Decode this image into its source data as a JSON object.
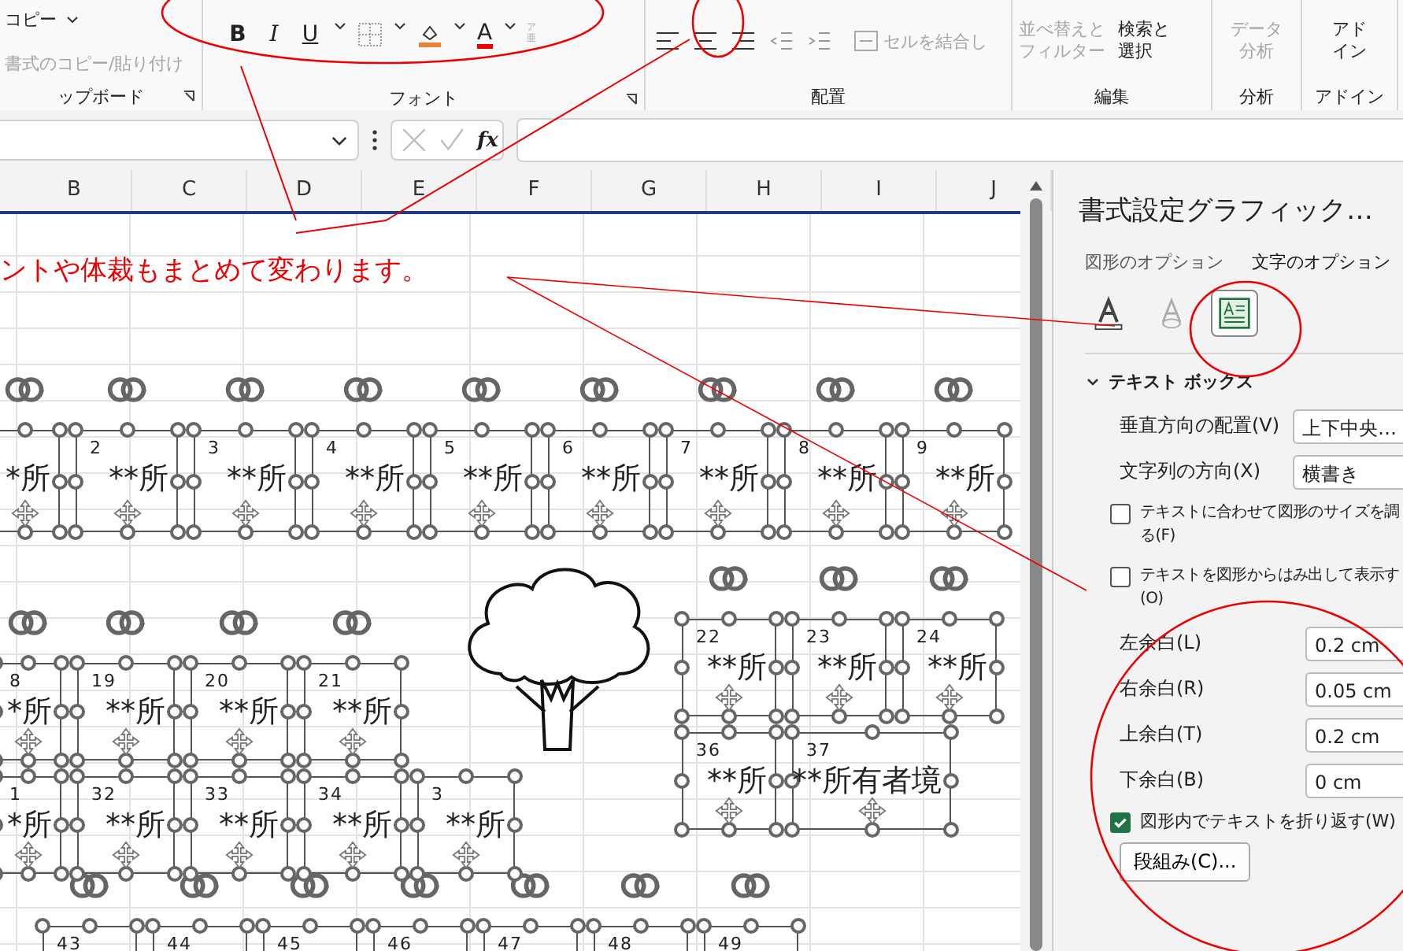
{
  "ribbon": {
    "clipboard": {
      "label": "ップボード",
      "copy": "コピー",
      "format_painter": {
        "label": "書式のコピー/貼り付け",
        "disabled": true
      }
    },
    "font": {
      "label": "フォント",
      "bold": "B",
      "italic": "I",
      "underline": "U",
      "font_color": "A",
      "phonetic": "ア亜"
    },
    "alignment": {
      "label": "配置",
      "merge": {
        "label": "セルを結合し",
        "disabled": true
      }
    },
    "editing": {
      "label": "編集",
      "sort_filter": {
        "lines": [
          "並べ替えと",
          "フィルター"
        ],
        "disabled": true
      },
      "find_select": {
        "lines": [
          "検索と",
          "選択"
        ],
        "disabled": false
      }
    },
    "analysis": {
      "label": "分析",
      "data_analysis": {
        "lines": [
          "データ",
          "分析"
        ],
        "disabled": true
      }
    },
    "addins": {
      "label": "アドイン",
      "addin": {
        "lines": [
          "アド",
          "イン"
        ]
      }
    }
  },
  "formula_bar": {
    "fx": "fx"
  },
  "columns": [
    "B",
    "C",
    "D",
    "E",
    "F",
    "G",
    "H",
    "I",
    "J"
  ],
  "annotation": "ントや体裁もまとめて変わります。",
  "shape_groups": [
    {
      "items": [
        {
          "text": "*所"
        },
        {
          "number": "2",
          "text": "**所"
        },
        {
          "number": "3",
          "text": "**所"
        },
        {
          "number": "4",
          "text": "**所"
        },
        {
          "number": "5",
          "text": "**所"
        },
        {
          "number": "6",
          "text": "**所"
        },
        {
          "number": "7",
          "text": "**所"
        },
        {
          "number": "8",
          "text": "**所"
        },
        {
          "number": "9",
          "text": "**所"
        }
      ]
    },
    {
      "items": [
        {
          "number": "8",
          "text": "*所"
        },
        {
          "number": "19",
          "text": "**所"
        },
        {
          "number": "20",
          "text": "**所"
        },
        {
          "number": "21",
          "text": "**所"
        }
      ]
    },
    {
      "items": [
        {
          "number": "1",
          "text": "*所"
        },
        {
          "number": "32",
          "text": "**所"
        },
        {
          "number": "33",
          "text": "**所"
        },
        {
          "number": "34",
          "text": "**所"
        },
        {
          "number": "3",
          "text": "**所"
        }
      ]
    },
    {
      "items": [
        {
          "number": "22",
          "text": "**所"
        },
        {
          "number": "23",
          "text": "**所"
        },
        {
          "number": "24",
          "text": "**所"
        }
      ]
    },
    {
      "items": [
        {
          "number": "36",
          "text": "**所"
        },
        {
          "number": "37",
          "text": "**所有者境"
        }
      ]
    },
    {
      "items": [
        {
          "number": "43"
        },
        {
          "number": "44"
        },
        {
          "number": "45"
        },
        {
          "number": "46"
        },
        {
          "number": "47"
        },
        {
          "number": "48"
        },
        {
          "number": "49"
        }
      ]
    }
  ],
  "panel": {
    "title": "書式設定グラフィック…",
    "tabs": [
      {
        "label": "図形のオプション",
        "selected": false
      },
      {
        "label": "文字のオプション",
        "selected": true
      }
    ],
    "icons": [
      {
        "kind": "fill",
        "selected": false
      },
      {
        "kind": "outline",
        "selected": false
      },
      {
        "kind": "textbox",
        "selected": true
      }
    ],
    "section": {
      "title": "テキスト ボックス",
      "expanded": true
    },
    "dropdowns": [
      {
        "label": "垂直方向の配置(V)",
        "value": "上下中央…"
      },
      {
        "label": "文字列の方向(X)",
        "value": "横書き"
      }
    ],
    "options": [
      {
        "lines": [
          "テキストに合わせて図形のサイズを調",
          "る(F)"
        ],
        "checked": false
      },
      {
        "lines": [
          "テキストを図形からはみ出して表示す",
          "(O)"
        ],
        "checked": false
      }
    ],
    "margins": [
      {
        "label": "左余白(L)",
        "value": "0.2 cm"
      },
      {
        "label": "右余白(R)",
        "value": "0.05 cm"
      },
      {
        "label": "上余白(T)",
        "value": "0.2 cm"
      },
      {
        "label": "下余白(B)",
        "value": "0 cm"
      }
    ],
    "wrap": {
      "label": "図形内でテキストを折り返す(W)",
      "checked": true
    },
    "columns_button": "段組み(C)..."
  }
}
